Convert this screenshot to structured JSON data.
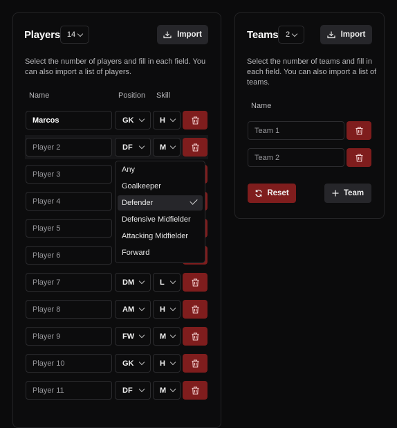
{
  "players": {
    "title": "Players",
    "count": "14",
    "import_label": "Import",
    "description_line1": "Select the number of players and fill in each field. You",
    "description_line2": "can also import a list of players.",
    "columns": {
      "name": "Name",
      "position": "Position",
      "skill": "Skill"
    },
    "rows": [
      {
        "name": "Marcos",
        "placeholder": "",
        "position": "GK",
        "skill": "H"
      },
      {
        "name": "",
        "placeholder": "Player 2",
        "position": "DF",
        "skill": "M"
      },
      {
        "name": "",
        "placeholder": "Player 3",
        "position": "",
        "skill": ""
      },
      {
        "name": "",
        "placeholder": "Player 4",
        "position": "",
        "skill": ""
      },
      {
        "name": "",
        "placeholder": "Player 5",
        "position": "",
        "skill": ""
      },
      {
        "name": "",
        "placeholder": "Player 6",
        "position": "",
        "skill": ""
      },
      {
        "name": "",
        "placeholder": "Player 7",
        "position": "DM",
        "skill": "L"
      },
      {
        "name": "",
        "placeholder": "Player 8",
        "position": "AM",
        "skill": "H"
      },
      {
        "name": "",
        "placeholder": "Player 9",
        "position": "FW",
        "skill": "M"
      },
      {
        "name": "",
        "placeholder": "Player 10",
        "position": "GK",
        "skill": "H"
      },
      {
        "name": "",
        "placeholder": "Player 11",
        "position": "DF",
        "skill": "M"
      }
    ]
  },
  "position_dropdown": {
    "options": [
      "Any",
      "Goalkeeper",
      "Defender",
      "Defensive Midfielder",
      "Attacking Midfielder",
      "Forward"
    ],
    "selected": "Defender"
  },
  "teams": {
    "title": "Teams",
    "count": "2",
    "import_label": "Import",
    "description_line1": "Select the number of teams and fill in",
    "description_line2": "each field. You can also import a list of",
    "description_line3": "teams.",
    "column_name": "Name",
    "rows": [
      {
        "placeholder": "Team 1"
      },
      {
        "placeholder": "Team 2"
      }
    ],
    "reset_label": "Reset",
    "add_team_label": "Team"
  },
  "colors": {
    "background": "#0b0b0c",
    "danger": "#7f1d1d",
    "secondary": "#26262a",
    "border": "#2c2c2f"
  }
}
